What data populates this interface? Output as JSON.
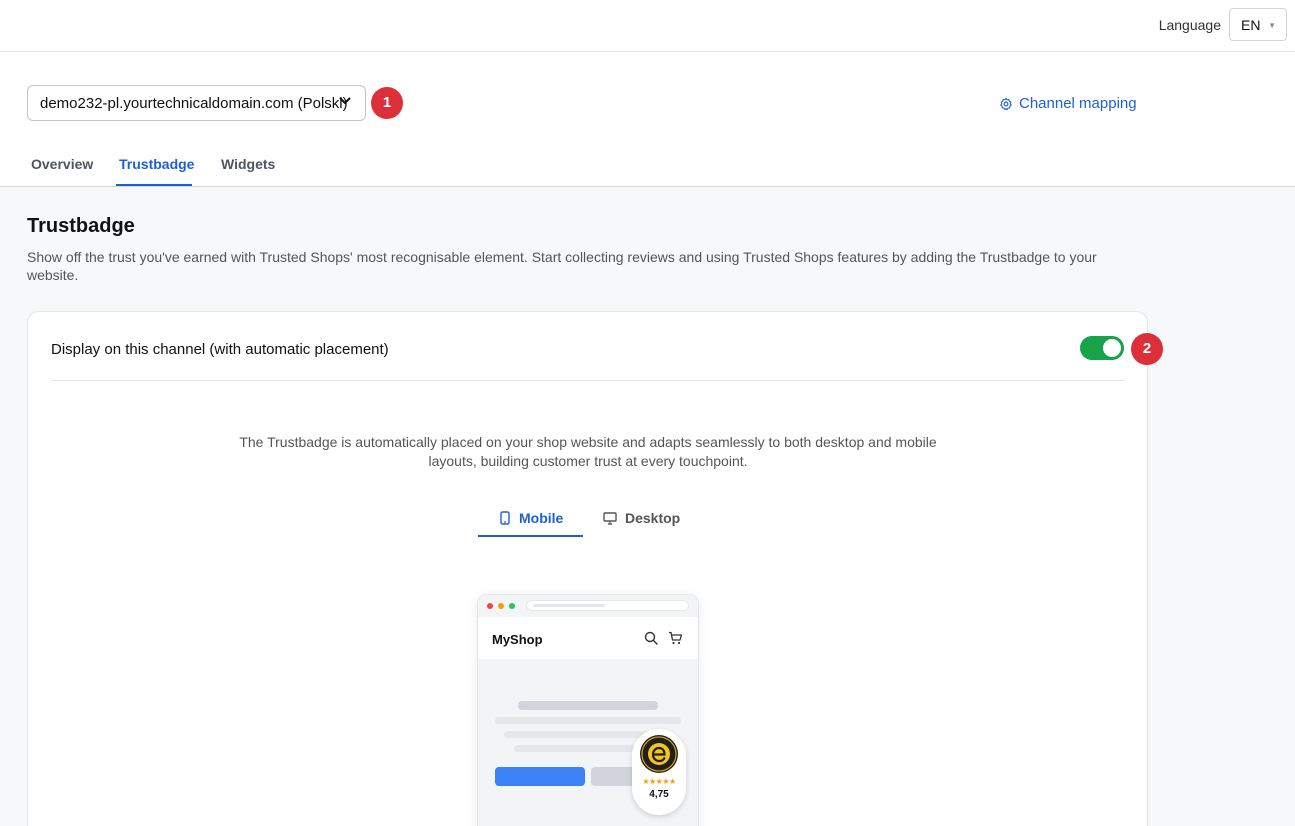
{
  "topbar": {
    "language_label": "Language",
    "language_value": "EN"
  },
  "header": {
    "domain_value": "demo232-pl.yourtechnicaldomain.com (Polski)",
    "step1": "1",
    "channel_mapping": "Channel mapping",
    "tabs": [
      {
        "label": "Overview",
        "active": false
      },
      {
        "label": "Trustbadge",
        "active": true
      },
      {
        "label": "Widgets",
        "active": false
      }
    ]
  },
  "main": {
    "title": "Trustbadge",
    "description": "Show off the trust you've earned with Trusted Shops' most recognisable element. Start collecting reviews and using Trusted Shops features by adding the Trustbadge to your website.",
    "card": {
      "toggle_label": "Display on this channel (with automatic placement)",
      "toggle_on": true,
      "step2": "2",
      "info": "The Trustbadge is automatically placed on your shop website and adapts seamlessly to both desktop and mobile layouts, building customer trust at every touchpoint.",
      "view_tabs": [
        {
          "label": "Mobile",
          "active": true
        },
        {
          "label": "Desktop",
          "active": false
        }
      ],
      "mockup": {
        "shop_name": "MyShop",
        "seal_rating": "4,75",
        "seal_stars": "★★★★★"
      }
    }
  },
  "colors": {
    "accent": "#1d5fd6",
    "toggle_on": "#16a34a",
    "step_badge": "#dc2f3a"
  }
}
